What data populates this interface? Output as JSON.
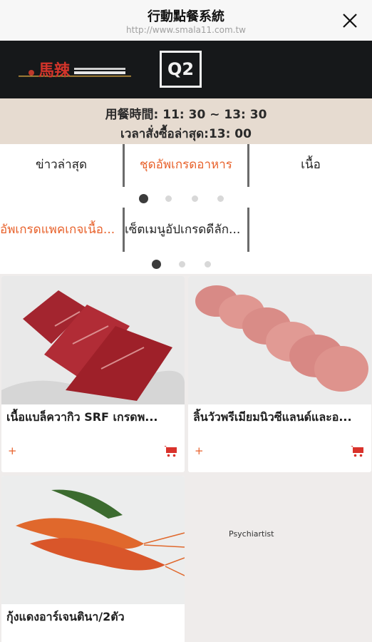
{
  "header": {
    "title": "行動點餐系統",
    "url": "http://www.smala11.com.tw"
  },
  "banner": {
    "logo_text": "馬辣",
    "table_number": "Q2"
  },
  "hours": {
    "line1": "用餐時間: 11: 30 ~ 13: 30",
    "line2": "เวลาสั่งซื้อล่าสุด:13: 00"
  },
  "tabs": [
    {
      "label": "ข่าวล่าสุด"
    },
    {
      "label": "ชุดอัพเกรดอาหาร"
    },
    {
      "label": "เนื้อ"
    }
  ],
  "subtabs": [
    {
      "label": "อัพเกรดแพคเกจเนื้อ..."
    },
    {
      "label": "เซ็ตเมนูอัปเกรดดีลัก..."
    }
  ],
  "products": [
    {
      "name": "เนื้อแบล็ควากิว SRF เกรดพ...",
      "add": "+"
    },
    {
      "name": "ลิ้นวัวพรีเมียมนิวซีแลนด์และอ...",
      "add": "+"
    },
    {
      "name": "กุ้งแดงอาร์เจนตินา/2ตัว",
      "add": "+"
    }
  ],
  "empty_slot_label": "Psychiartist",
  "colors": {
    "accent": "#e8622c",
    "banner": "#16181a",
    "time_bar": "#e6dbd0",
    "background": "#efeceb"
  }
}
